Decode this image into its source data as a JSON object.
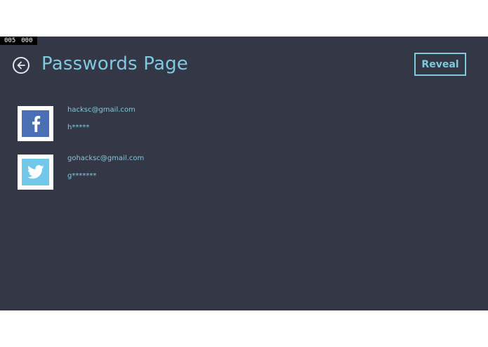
{
  "header": {
    "counter": [
      "005",
      "000"
    ],
    "title": "Passwords Page",
    "reveal_label": "Reveal"
  },
  "accounts": [
    {
      "service_icon": "facebook-icon",
      "email": "hacksc@gmail.com",
      "password": "h*****"
    },
    {
      "service_icon": "twitter-icon",
      "email": "gohacksc@gmail.com",
      "password": "g*******"
    }
  ],
  "colors": {
    "background": "#333746",
    "accent": "#7fc9de",
    "facebook": "#4a6fb5",
    "twitter": "#72c8ea"
  }
}
